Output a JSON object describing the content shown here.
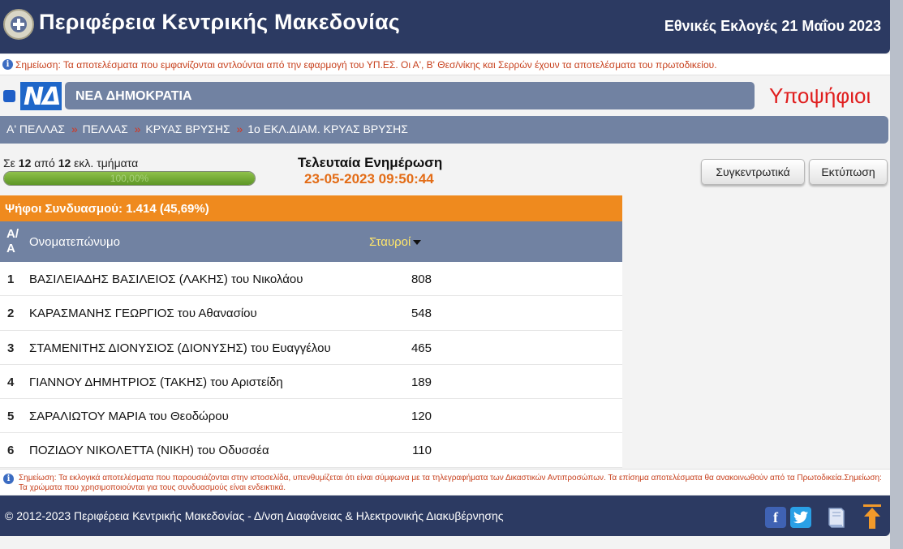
{
  "header": {
    "region_title": "Περιφέρεια Κεντρικής Μακεδονίας",
    "election_title": "Εθνικές Εκλογές 21 Μαΐου 2023"
  },
  "note": "Σημείωση: Τα αποτελέσματα που εμφανίζονται αντλούνται από την εφαρμογή του ΥΠ.ΕΣ. Οι Α', Β' Θεσ/νίκης και Σερρών έχουν τα αποτελέσματα του πρωτοδικείου.",
  "party": {
    "logo_text": "ΝΔ",
    "name": "ΝΕΑ ΔΗΜΟΚΡΑΤΙΑ",
    "color": "#1f67c9"
  },
  "candidates_heading": "Υποψήφιοι",
  "breadcrumb": [
    "Α'  ΠΕΛΛΑΣ",
    "ΠΕΛΛΑΣ",
    "ΚΡΥΑΣ ΒΡΥΣΗΣ",
    "1ο ΕΚΛ.ΔΙΑΜ. ΚΡΥΑΣ ΒΡΥΣΗΣ"
  ],
  "breadcrumb_separator": "»",
  "progress": {
    "prefix": "Σε",
    "counted": "12",
    "middle": "από",
    "total": "12",
    "suffix": "εκλ. τμήματα",
    "percent_label": "100,00%",
    "fraction": 1.0
  },
  "last_update": {
    "label": "Τελευταία Ενημέρωση",
    "timestamp": "23-05-2023 09:50:44"
  },
  "buttons": {
    "summary": "Συγκεντρωτικά",
    "print": "Εκτύπωση"
  },
  "table": {
    "votes_summary": "Ψήφοι Συνδυασμού: 1.414 (45,69%)",
    "headers": {
      "index": "Α/Α",
      "name": "Ονοματεπώνυμο",
      "crosses": "Σταυροί"
    },
    "rows": [
      {
        "num": "1",
        "name": "ΒΑΣΙΛΕΙΑΔΗΣ ΒΑΣΙΛΕΙΟΣ (ΛΑΚΗΣ) του Νικολάου",
        "votes": "808"
      },
      {
        "num": "2",
        "name": "ΚΑΡΑΣΜΑΝΗΣ ΓΕΩΡΓΙΟΣ του Αθανασίου",
        "votes": "548"
      },
      {
        "num": "3",
        "name": "ΣΤΑΜΕΝΙΤΗΣ ΔΙΟΝΥΣΙΟΣ (ΔΙΟΝΥΣΗΣ) του Ευαγγέλου",
        "votes": "465"
      },
      {
        "num": "4",
        "name": "ΓΙΑΝΝΟΥ ΔΗΜΗΤΡΙΟΣ (ΤΑΚΗΣ) του Αριστείδη",
        "votes": "189"
      },
      {
        "num": "5",
        "name": "ΣΑΡΑΛΙΩΤΟΥ ΜΑΡΙΑ του Θεοδώρου",
        "votes": "120"
      },
      {
        "num": "6",
        "name": "ΠΟΖΙΔΟΥ ΝΙΚΟΛΕΤΤΑ (ΝΙΚΗ) του Οδυσσέα",
        "votes": "110"
      }
    ]
  },
  "disclaimer": "Σημείωση: Τα εκλογικά αποτελέσματα που παρουσιάζονται στην ιστοσελίδα, υπενθυμίζεται ότι είναι σύμφωνα με τα τηλεγραφήματα των Δικαστικών Αντιπροσώπων. Τα επίσημα αποτελέσματα θα ανακοινωθούν από τα Πρωτοδικεία.Σημείωση: Τα χρώματα που χρησιμοποιούνται για τους συνδυασμούς είναι ενδεικτικά.",
  "footer": {
    "copyright": "© 2012-2023 Περιφέρεια Κεντρικής Μακεδονίας - Δ/νση Διαφάνειας & Ηλεκτρονικής Διακυβέρνησης",
    "icons": [
      "facebook-icon",
      "twitter-icon",
      "book-icon",
      "scroll-top-icon"
    ]
  },
  "colors": {
    "header_bg": "#2c3a62",
    "bar_bg": "#7182a2",
    "accent_orange": "#ef8a1e",
    "note_red": "#c7401d",
    "heading_red": "#e01e1e"
  }
}
